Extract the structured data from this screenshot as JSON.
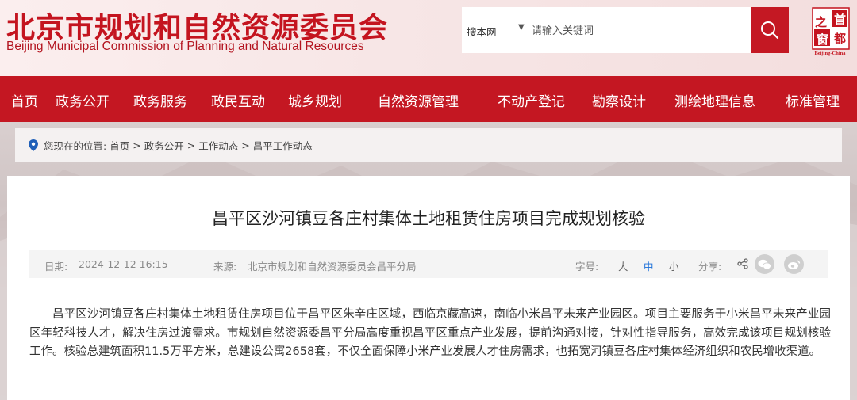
{
  "header": {
    "title_cn": "北京市规划和自然资源委员会",
    "title_en": "Beijing Municipal Commission of Planning and Natural Resources",
    "search": {
      "scope": "搜本网",
      "placeholder": "请输入关键词"
    },
    "logo": {
      "char_1": "之",
      "char_2": "首",
      "char_3": "都",
      "char_4": "窗",
      "caption": "Beijing-China"
    }
  },
  "nav": {
    "items": [
      {
        "label": "首页"
      },
      {
        "label": "政务公开"
      },
      {
        "label": "政务服务"
      },
      {
        "label": "政民互动"
      },
      {
        "label": "城乡规划"
      },
      {
        "label": "自然资源管理"
      },
      {
        "label": "不动产登记"
      },
      {
        "label": "勘察设计"
      },
      {
        "label": "测绘地理信息"
      },
      {
        "label": "标准管理"
      }
    ]
  },
  "breadcrumb": {
    "prefix": "您现在的位置:",
    "items": [
      "首页",
      "政务公开",
      "工作动态",
      "昌平工作动态"
    ],
    "separator": ">"
  },
  "article": {
    "title": "昌平区沙河镇豆各庄村集体土地租赁住房项目完成规划核验",
    "date_label": "日期:",
    "date": "2024-12-12 16:15",
    "source_label": "来源:",
    "source": "北京市规划和自然资源委员会昌平分局",
    "font_size_label": "字号:",
    "font_sizes": {
      "large": "大",
      "medium": "中",
      "small": "小"
    },
    "share_label": "分享:",
    "body": "昌平区沙河镇豆各庄村集体土地租赁住房项目位于昌平区朱辛庄区域，西临京藏高速，南临小米昌平未来产业园区。项目主要服务于小米昌平未来产业园区年轻科技人才，解决住房过渡需求。市规划自然资源委昌平分局高度重视昌平区重点产业发展，提前沟通对接，针对性指导服务，高效完成该项目规划核验工作。核验总建筑面积11.5万平方米，总建设公寓2658套，不仅全面保障小米产业发展人才住房需求，也拓宽河镇豆各庄村集体经济组织和农民增收渠道。"
  },
  "colors": {
    "brand_red": "#c41722",
    "title_red": "#c4141f",
    "active_font_size": "#1a6ed8"
  }
}
